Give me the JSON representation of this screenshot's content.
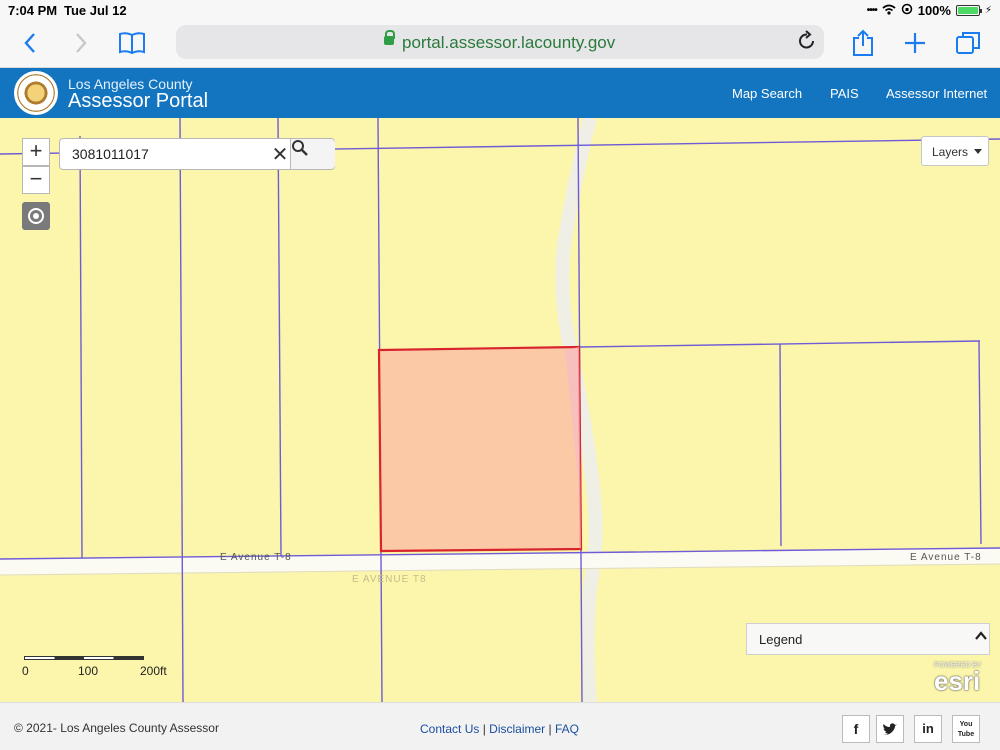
{
  "status_bar": {
    "time": "7:04 PM",
    "date": "Tue Jul 12",
    "battery": "100%",
    "battery_level": 1.0
  },
  "browser": {
    "url": "portal.assessor.lacounty.gov",
    "icons": [
      "back-icon",
      "forward-icon",
      "bookmarks-icon",
      "lock-icon",
      "reload-icon",
      "share-icon",
      "new-tab-icon",
      "tabs-icon"
    ]
  },
  "header": {
    "county": "Los Angeles County",
    "title": "Assessor Portal",
    "nav": [
      "Map Search",
      "PAIS",
      "Assessor Internet"
    ],
    "bg_color": "#1374c0"
  },
  "map": {
    "search_value": "3081011017",
    "zoom_in": "+",
    "zoom_out": "−",
    "layers_label": "Layers",
    "streets": {
      "left": "E Avenue T-8",
      "right": "E Avenue T-8",
      "faint": "E AVENUE T8"
    },
    "legend_label": "Legend",
    "scale": [
      "0",
      "100",
      "200ft"
    ],
    "esri_powered": "POWERED BY",
    "esri_word": "esri",
    "colors": {
      "land": "#fbf6ab",
      "parcel_line": "#6f5bd6",
      "selected_fill": "#fbc9a6",
      "selected_outline": "#d8242c"
    }
  },
  "footer": {
    "copyright": "© 2021- Los Angeles County Assessor",
    "links": [
      "Contact Us",
      "Disclaimer",
      "FAQ"
    ],
    "separator": "|",
    "social": [
      "f",
      "t",
      "in",
      "You Tube"
    ]
  }
}
